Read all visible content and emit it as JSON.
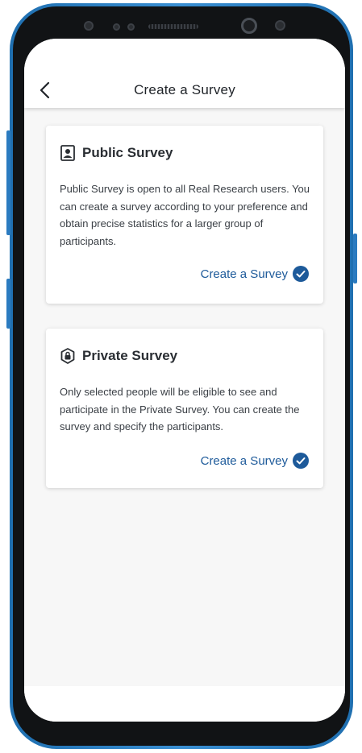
{
  "header": {
    "title": "Create a Survey",
    "back_icon": "chevron-left-icon"
  },
  "cards": [
    {
      "title": "Public Survey",
      "icon": "contact-card-icon",
      "description": "Public Survey is open to all Real Research users. You can create a survey according to your preference and obtain precise statistics for a larger group of participants.",
      "action_label": "Create a Survey",
      "action_icon": "check-circle-icon"
    },
    {
      "title": "Private Survey",
      "icon": "lock-shield-icon",
      "description": "Only selected people will be eligible to see and participate in the Private Survey. You can create the survey and specify the participants.",
      "action_label": "Create a Survey",
      "action_icon": "check-circle-icon"
    }
  ],
  "colors": {
    "accent": "#1d5a9a",
    "frame": "#2b7bc0"
  }
}
